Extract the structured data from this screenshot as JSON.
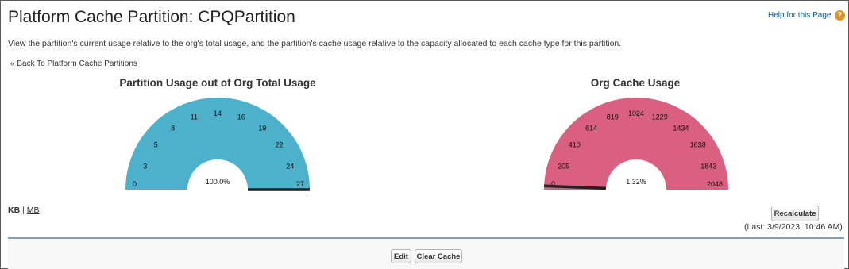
{
  "page": {
    "title": "Platform Cache Partition: CPQPartition",
    "help_link": "Help for this Page",
    "help_icon": "question-icon",
    "description": "View the partition's current usage relative to the org's total usage, and the partition's cache usage relative to the capacity allocated to each cache type for this partition.",
    "back_prefix": "«",
    "back_link": "Back To Platform Cache Partitions"
  },
  "gauges": {
    "partition": {
      "title": "Partition Usage out of Org Total Usage",
      "ticks": [
        "0",
        "3",
        "5",
        "8",
        "11",
        "14",
        "16",
        "19",
        "22",
        "24",
        "27"
      ],
      "value_label": "100.0%",
      "value_fraction": 1.0,
      "color": "#4eb1cc"
    },
    "org": {
      "title": "Org Cache Usage",
      "ticks": [
        "0",
        "205",
        "410",
        "614",
        "819",
        "1024",
        "1229",
        "1434",
        "1638",
        "1843",
        "2048"
      ],
      "value_label": "1.32%",
      "value_fraction": 0.0132,
      "color": "#d9607f"
    },
    "needle_color": "#222222"
  },
  "units": {
    "kb": "KB",
    "separator": "|",
    "mb": "MB"
  },
  "actions": {
    "recalculate": "Recalculate",
    "last": "(Last: 3/9/2023, 10:46 AM)",
    "edit": "Edit",
    "clear_cache": "Clear Cache"
  }
}
